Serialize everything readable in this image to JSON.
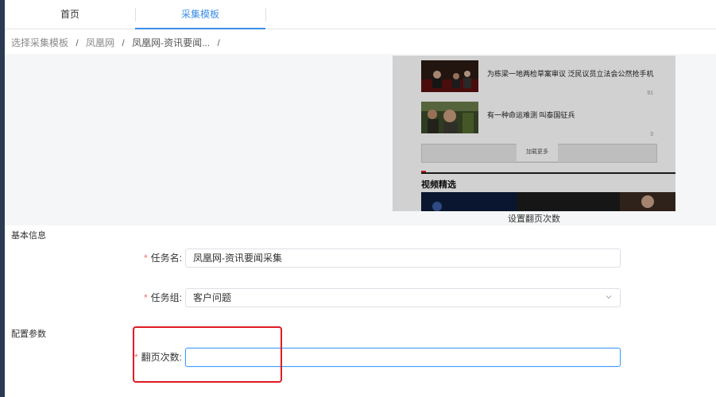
{
  "tabs": [
    {
      "label": "首页",
      "active": false
    },
    {
      "label": "采集模板",
      "active": true
    }
  ],
  "breadcrumb": {
    "items": [
      "选择采集模板",
      "凤凰网",
      "凤凰网-资讯要闻..."
    ],
    "separator": "/"
  },
  "preview": {
    "news": [
      {
        "title": "为栋梁一地两检草案审议 泛民议员立法会公然抢手机",
        "count": "91"
      },
      {
        "title": "有一种命运难测 叫泰国征兵",
        "count": "3"
      }
    ],
    "load_more": "加载更多",
    "video_section": "视频精选",
    "caption": "设置翻页次数"
  },
  "sections": {
    "basic": "基本信息",
    "config": "配置参数"
  },
  "form": {
    "task_name": {
      "label": "任务名:",
      "value": "凤凰网-资讯要闻采集"
    },
    "task_group": {
      "label": "任务组:",
      "value": "客户问题"
    },
    "page_turns": {
      "label": "翻页次数:",
      "value": ""
    }
  },
  "colors": {
    "accent": "#3a8ee6",
    "required": "#f56c6c",
    "highlight": "#e01b24",
    "sidebar": "#2b3a53"
  }
}
